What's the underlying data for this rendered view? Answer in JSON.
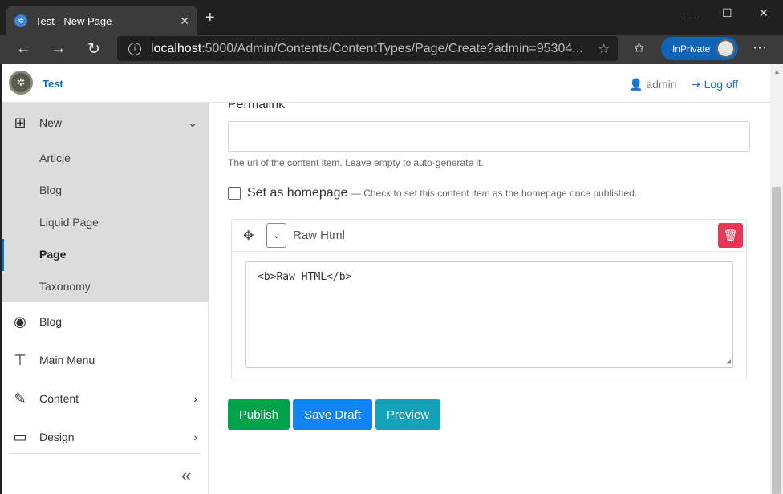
{
  "browser": {
    "tab_title": "Test - New Page",
    "url_host": "localhost",
    "url_path": ":5000/Admin/Contents/ContentTypes/Page/Create?admin=95304...",
    "inprivate_label": "InPrivate"
  },
  "header": {
    "brand": "Test",
    "user": "admin",
    "logout": "Log off"
  },
  "sidebar": {
    "new_label": "New",
    "sub_items": [
      "Article",
      "Blog",
      "Liquid Page",
      "Page",
      "Taxonomy"
    ],
    "active_sub_item": "Page",
    "items": [
      "Blog",
      "Main Menu",
      "Content",
      "Design"
    ]
  },
  "form": {
    "permalink_label": "Permalink",
    "permalink_value": "",
    "permalink_help": "The url of the content item. Leave empty to auto-generate it.",
    "homepage_label": "Set as homepage",
    "homepage_help": "— Check to set this content item as the homepage once published.",
    "homepage_checked": false,
    "widget_title": "Raw Html",
    "raw_html_value": "<b>Raw HTML</b>"
  },
  "actions": {
    "publish": "Publish",
    "save_draft": "Save Draft",
    "preview": "Preview"
  },
  "colors": {
    "publish": "#00a34a",
    "save_draft": "#1183f5",
    "preview": "#14a2b8",
    "delete": "#e63757",
    "link": "#1b6ed1"
  }
}
